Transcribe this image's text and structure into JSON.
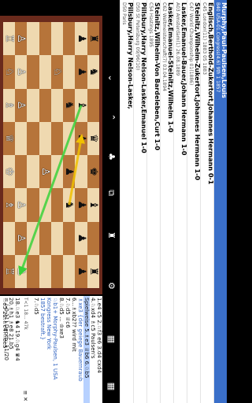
{
  "games": [
    {
      "players": "Murphy,Paul-Paulsen,Louis",
      "info": "B40 USA-01.Congress(4.6) 9th 1 1857",
      "selected": true
    },
    {
      "players": "Englisch,Berthold-Zukertort,Johannes Hermann 0-1",
      "info": "C45 London(11) 1883 05 1883"
    },
    {
      "players": "Steinitz,Wilhelm-Zukertort,Johannes Hermann 1-0",
      "info": "C47 World Championship 01(1886)"
    },
    {
      "players": "Lasker,Emanuel-Bauer,Johann Hermann 1-0",
      "info": "A03 Amsterdam(1) 26.08.1889"
    },
    {
      "players": "Lasker,Emanuel-Steinitz,Wilhelm 1-0",
      "info": "C62 Weltmeisterschaft(7) 03.04.1894"
    },
    {
      "players": "Steinitz,Wilhelm-Von Bardeleben,Curt 1-0",
      "info": "C54 Hastings 1895"
    },
    {
      "players": "Pillsbury,Harry Nelson-Lasker,Emanuel 1-0",
      "info": "D50 St Petersburg 09/96(10)"
    },
    {
      "players": "Pillsbury,Harry Nelson-Lasker,",
      "info": "D50 Paris"
    }
  ],
  "toolbar": {
    "icons": [
      "grid-icon",
      "grid-icon",
      "gear-icon",
      "pieces-icon",
      "hierarchy-icon",
      "tree-icon",
      "chevron-up-icon",
      "chevron-down-icon"
    ]
  },
  "board": {
    "light": "#efd9b0",
    "dark": "#b6743a",
    "frame": "#6a2a1c",
    "pieces": [
      {
        "sq": "a8",
        "p": "♜",
        "c": "b"
      },
      {
        "sq": "b8",
        "p": "♞",
        "c": "b"
      },
      {
        "sq": "d8",
        "p": "♛",
        "c": "b"
      },
      {
        "sq": "e8",
        "p": "♚",
        "c": "b"
      },
      {
        "sq": "f8",
        "p": "♝",
        "c": "b"
      },
      {
        "sq": "h8",
        "p": "♜",
        "c": "b"
      },
      {
        "sq": "a7",
        "p": "♟",
        "c": "b"
      },
      {
        "sq": "b7",
        "p": "♟",
        "c": "b"
      },
      {
        "sq": "c7",
        "p": "♝",
        "c": "b"
      },
      {
        "sq": "d7",
        "p": "♟",
        "c": "b"
      },
      {
        "sq": "f7",
        "p": "♟",
        "c": "b"
      },
      {
        "sq": "g7",
        "p": "♟",
        "c": "b"
      },
      {
        "sq": "h7",
        "p": "♟",
        "c": "b"
      },
      {
        "sq": "c6",
        "p": "♞",
        "c": "b"
      },
      {
        "sq": "e6",
        "p": "♟",
        "c": "b"
      },
      {
        "sq": "f6",
        "p": "♞",
        "c": "b"
      },
      {
        "sq": "b5",
        "p": "♘",
        "c": "w"
      },
      {
        "sq": "e4",
        "p": "♙",
        "c": "w"
      },
      {
        "sq": "a2",
        "p": "♙",
        "c": "w"
      },
      {
        "sq": "b2",
        "p": "♙",
        "c": "w"
      },
      {
        "sq": "c2",
        "p": "♙",
        "c": "w"
      },
      {
        "sq": "f2",
        "p": "♙",
        "c": "w"
      },
      {
        "sq": "g2",
        "p": "♙",
        "c": "w"
      },
      {
        "sq": "h2",
        "p": "♙",
        "c": "w"
      },
      {
        "sq": "a1",
        "p": "♖",
        "c": "w"
      },
      {
        "sq": "b1",
        "p": "♘",
        "c": "w"
      },
      {
        "sq": "c1",
        "p": "♗",
        "c": "w"
      },
      {
        "sq": "d1",
        "p": "♕",
        "c": "w"
      },
      {
        "sq": "e1",
        "p": "♔",
        "c": "w"
      },
      {
        "sq": "f1",
        "p": "♗",
        "c": "w"
      },
      {
        "sq": "h1",
        "p": "♖",
        "c": "w"
      }
    ],
    "arrows": [
      {
        "from": "f6",
        "to": "d7",
        "color": "#f0c000"
      },
      {
        "from": "c7",
        "to": "h2",
        "color": "#3bd13b"
      }
    ]
  },
  "notation": {
    "lines": [
      {
        "t": "1.e4 c5 2.♘f3 e6 3.d4 cxd4",
        "style": ""
      },
      {
        "t": "4.♘xd4 ♗c5 Paulsen's",
        "style": ""
      },
      {
        "t": "Spielweise 5.♗e3 ♕b6 6.♘b5",
        "style": "hl"
      },
      {
        "t": "♗xe3 {der geiege Bauernraub",
        "style": "blue"
      },
      {
        "t": "6...♗xb2?? wird mit",
        "style": ""
      },
      {
        "t": "7.♘d5 ♕c6",
        "style": ""
      },
      {
        "t": "8.♘d5 ... ♔xe3",
        "style": ""
      },
      {
        "t": "♘b1+ Morphy-Paulsen, 1 USA",
        "style": "blue"
      },
      {
        "t": "Kongress New York",
        "style": "blue"
      },
      {
        "t": "1857 bestraft.}",
        "style": "blue"
      },
      {
        "t": "7.♘d5",
        "style": ""
      }
    ],
    "nav_left": "T<1 18... 47k",
    "nav_right": "≡ ✕",
    "tail": [
      "18.♘e3 ♞4 19.♘g4 ♛4",
      "20.♗h1 ♗e8 21.b5",
      "♘e5 22.♗c4 ♘ee5"
    ],
    "eval": "= (-0.11) Depth: 11/20"
  }
}
